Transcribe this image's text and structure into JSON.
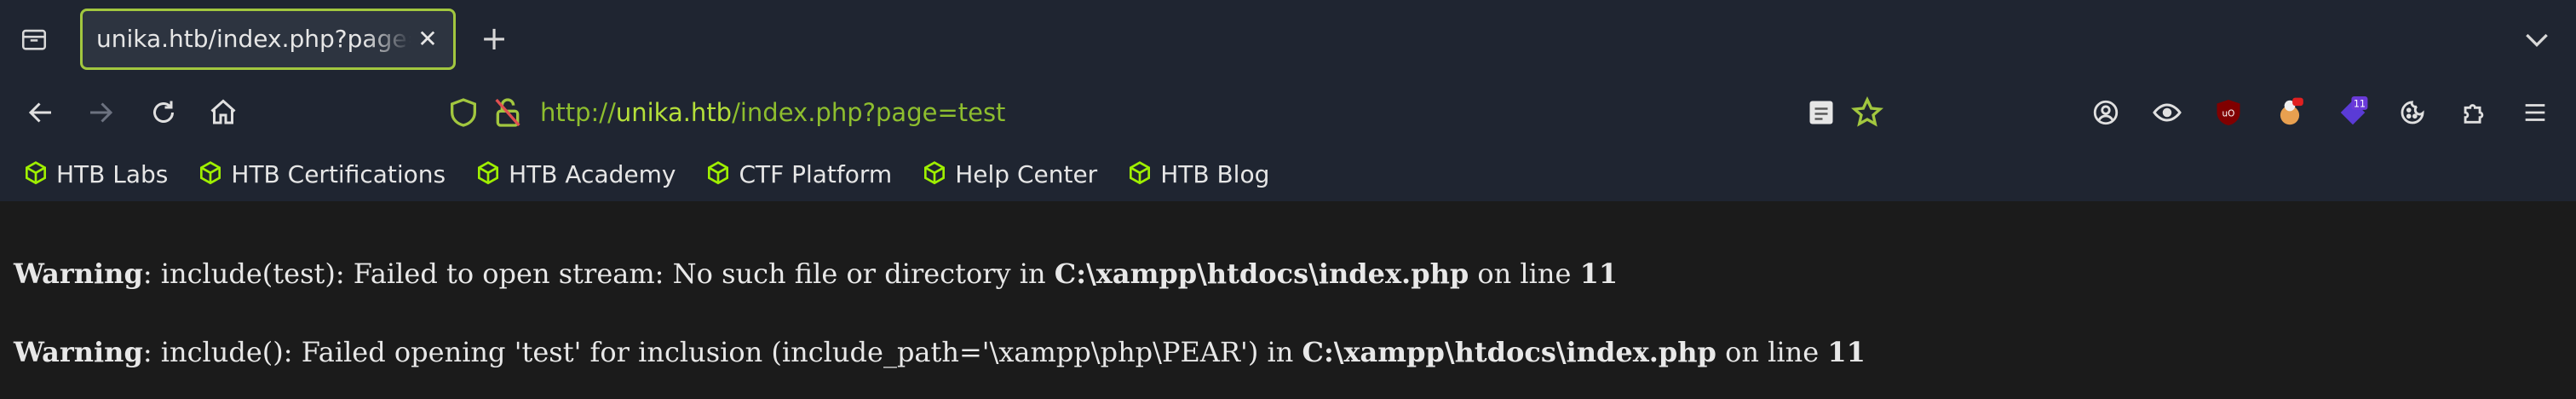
{
  "tab": {
    "title": "unika.htb/index.php?page=test",
    "close_glyph": "✕",
    "new_tab_glyph": "+"
  },
  "urlbar": {
    "scheme": "http://",
    "host": "unika.htb",
    "path": "/index.php?page=test"
  },
  "bookmarks": [
    {
      "label": "HTB Labs"
    },
    {
      "label": "HTB Certifications"
    },
    {
      "label": "HTB Academy"
    },
    {
      "label": "CTF Platform"
    },
    {
      "label": "Help Center"
    },
    {
      "label": "HTB Blog"
    }
  ],
  "extensions": {
    "notification_count": "11"
  },
  "warnings": [
    {
      "label": "Warning",
      "message": ": include(test): Failed to open stream: No such file or directory in ",
      "file": "C:\\xampp\\htdocs\\index.php",
      "line_text": " on line ",
      "line": "11"
    },
    {
      "label": "Warning",
      "message": ": include(): Failed opening 'test' for inclusion (include_path='\\xampp\\php\\PEAR') in ",
      "file": "C:\\xampp\\htdocs\\index.php",
      "line_text": " on line ",
      "line": "11"
    }
  ],
  "colors": {
    "accent": "#a2c73f",
    "url_host": "#b5e03a",
    "url_path": "#8ebe2e",
    "chrome_bg": "#1f2531",
    "page_bg": "#1b1b1b"
  }
}
